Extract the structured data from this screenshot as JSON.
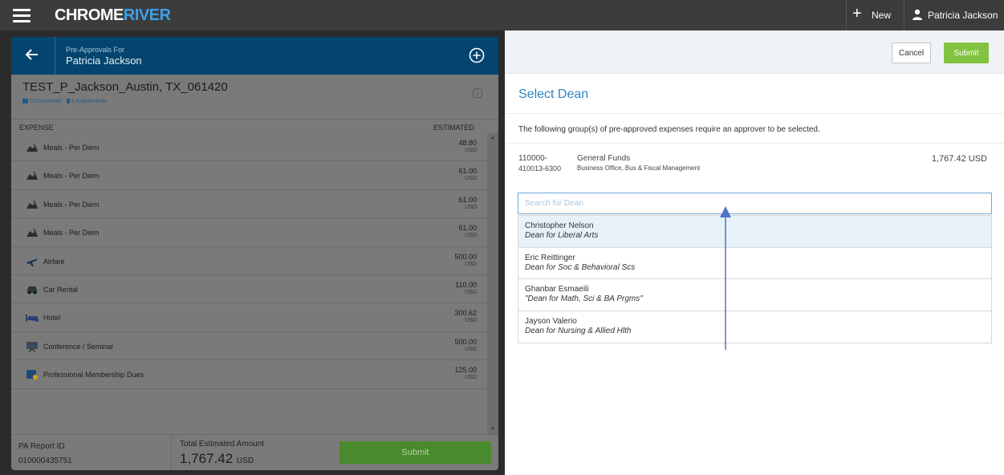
{
  "topbar": {
    "brand_part1": "CHROME",
    "brand_part2": "RIVER",
    "new_label": "New",
    "user_name": "Patricia Jackson"
  },
  "left_panel": {
    "header_sub": "Pre-Approvals For",
    "header_name": "Patricia Jackson",
    "report_title": "TEST_P_Jackson_Austin, TX_061420",
    "comments": "0 Comments",
    "attachments": "3 Attachments",
    "col_expense": "EXPENSE",
    "col_estimated": "ESTIMATED",
    "expenses": [
      {
        "name": "Meals - Per Diem",
        "amount": "48.80",
        "currency": "USD",
        "icon": "meals-icon"
      },
      {
        "name": "Meals - Per Diem",
        "amount": "61.00",
        "currency": "USD",
        "icon": "meals-icon"
      },
      {
        "name": "Meals - Per Diem",
        "amount": "61.00",
        "currency": "USD",
        "icon": "meals-icon"
      },
      {
        "name": "Meals - Per Diem",
        "amount": "61.00",
        "currency": "USD",
        "icon": "meals-icon"
      },
      {
        "name": "Airfare",
        "amount": "500.00",
        "currency": "USD",
        "icon": "airplane-icon"
      },
      {
        "name": "Car Rental",
        "amount": "110.00",
        "currency": "USD",
        "icon": "car-icon"
      },
      {
        "name": "Hotel",
        "amount": "300.62",
        "currency": "USD",
        "icon": "bed-icon"
      },
      {
        "name": "Conference / Seminar",
        "amount": "500.00",
        "currency": "USD",
        "icon": "conference-icon"
      },
      {
        "name": "Professional Membership Dues",
        "amount": "125.00",
        "currency": "USD",
        "icon": "membership-icon"
      }
    ],
    "pa_report_id_label": "PA Report ID",
    "pa_report_id": "010000435751",
    "total_label": "Total Estimated Amount",
    "total_amount": "1,767.42",
    "total_currency": "USD",
    "submit_label": "Submit"
  },
  "right_panel": {
    "cancel_label": "Cancel",
    "submit_label": "Submit",
    "title": "Select Dean",
    "instructions": "The following group(s) of pre-approved expenses require an approver to be selected.",
    "fund": {
      "code_line1": "110000-",
      "code_line2": "410013-6300",
      "name": "General Funds",
      "dept": "Business Office, Bus & Fiscal Management",
      "amount": "1,767.42 USD"
    },
    "search_placeholder": "Search for Dean",
    "deans": [
      {
        "name": "Christopher Nelson",
        "title": "Dean for Liberal Arts"
      },
      {
        "name": "Eric Reittinger",
        "title": "Dean for Soc & Behavioral Scs"
      },
      {
        "name": "Ghanbar Esmaeili",
        "title": "\"Dean for Math, Sci & BA Prgms\""
      },
      {
        "name": "Jayson Valerio",
        "title": "Dean for Nursing & Allied Hlth"
      }
    ]
  },
  "colors": {
    "header_blue": "#03456e",
    "accent_blue": "#2e86c1",
    "submit_green": "#82c341",
    "topbar": "#3c3c3c"
  }
}
